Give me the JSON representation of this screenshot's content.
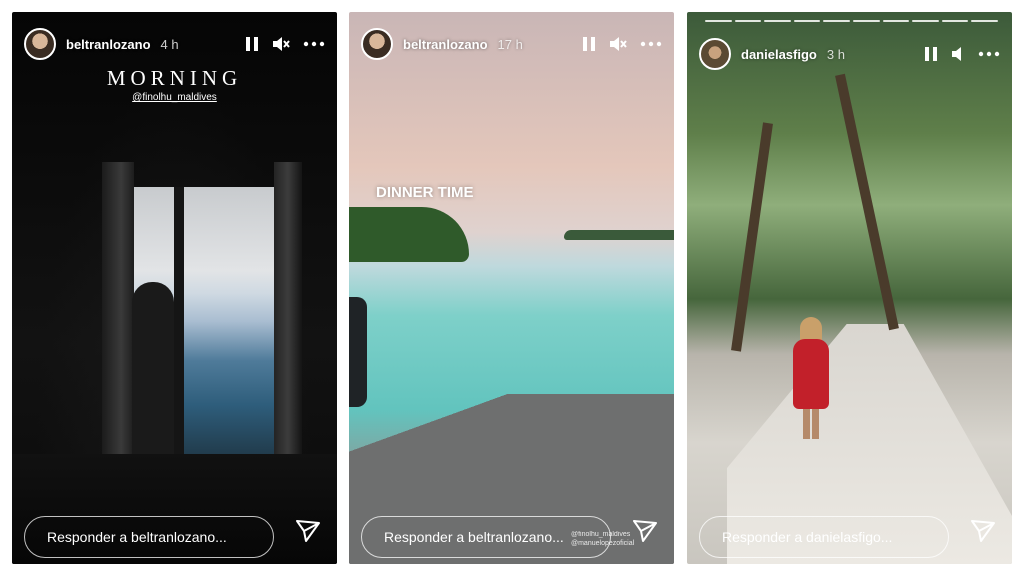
{
  "stories": [
    {
      "username": "beltranlozano",
      "time": "4 h",
      "overlay_title": "MORNING",
      "overlay_mention": "@finolhu_maldives",
      "reply_placeholder": "Responder a beltranlozano..."
    },
    {
      "username": "beltranlozano",
      "time": "17 h",
      "caption": "DINNER TIME",
      "overlay_mention": "@finolhu_maldives @manuelopezoficial",
      "reply_placeholder": "Responder a beltranlozano..."
    },
    {
      "username": "danielasfigo",
      "time": "3 h",
      "progress_segments": 10,
      "reply_placeholder": "Responder a danielasfigo..."
    }
  ],
  "icons": {
    "pause": "pause-icon",
    "mute": "speaker-muted-icon",
    "sound": "speaker-icon",
    "more": "more-options-icon",
    "send": "send-icon"
  }
}
